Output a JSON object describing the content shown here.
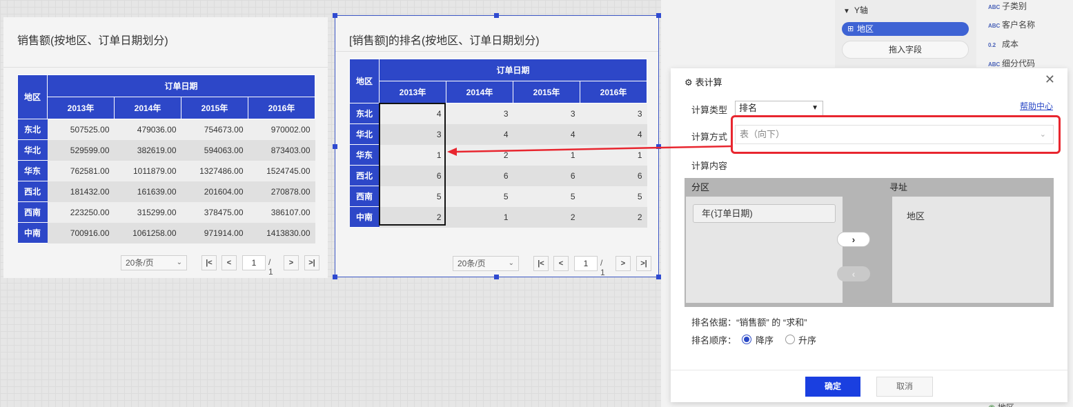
{
  "widget1": {
    "title": "销售额(按地区、订单日期划分)",
    "table": {
      "region_header": "地区",
      "group_header": "订单日期",
      "years": [
        "2013年",
        "2014年",
        "2015年",
        "2016年"
      ],
      "rows": [
        {
          "region": "东北",
          "values": [
            "507525.00",
            "479036.00",
            "754673.00",
            "970002.00"
          ]
        },
        {
          "region": "华北",
          "values": [
            "529599.00",
            "382619.00",
            "594063.00",
            "873403.00"
          ]
        },
        {
          "region": "华东",
          "values": [
            "762581.00",
            "1011879.00",
            "1327486.00",
            "1524745.00"
          ]
        },
        {
          "region": "西北",
          "values": [
            "181432.00",
            "161639.00",
            "201604.00",
            "270878.00"
          ]
        },
        {
          "region": "西南",
          "values": [
            "223250.00",
            "315299.00",
            "378475.00",
            "386107.00"
          ]
        },
        {
          "region": "中南",
          "values": [
            "700916.00",
            "1061258.00",
            "971914.00",
            "1413830.00"
          ]
        }
      ]
    },
    "pager": {
      "page_size": "20条/页",
      "page": "1",
      "total": "/ 1"
    }
  },
  "widget2": {
    "title": "[销售额]的排名(按地区、订单日期划分)",
    "table": {
      "region_header": "地区",
      "group_header": "订单日期",
      "years": [
        "2013年",
        "2014年",
        "2015年",
        "2016年"
      ],
      "rows": [
        {
          "region": "东北",
          "values": [
            "4",
            "3",
            "3",
            "3"
          ]
        },
        {
          "region": "华北",
          "values": [
            "3",
            "4",
            "4",
            "4"
          ]
        },
        {
          "region": "华东",
          "values": [
            "1",
            "2",
            "1",
            "1"
          ]
        },
        {
          "region": "西北",
          "values": [
            "6",
            "6",
            "6",
            "6"
          ]
        },
        {
          "region": "西南",
          "values": [
            "5",
            "5",
            "5",
            "5"
          ]
        },
        {
          "region": "中南",
          "values": [
            "2",
            "1",
            "2",
            "2"
          ]
        }
      ]
    },
    "pager": {
      "page_size": "20条/页",
      "page": "1",
      "total": "/ 1"
    }
  },
  "right_panel": {
    "y_axis_label": "Y轴",
    "y_field": "地区",
    "drop_placeholder": "拖入字段",
    "fields": [
      {
        "type": "ABC",
        "name": "子类别"
      },
      {
        "type": "ABC",
        "name": "客户名称"
      },
      {
        "type": "0.2",
        "name": "成本"
      },
      {
        "type": "ABC",
        "name": "细分代码"
      }
    ],
    "bottom_field_partial": "地区"
  },
  "dialog": {
    "title": "表计算",
    "calc_type_label": "计算类型",
    "calc_type_value": "排名",
    "help_link": "帮助中心",
    "calc_method_label": "计算方式",
    "calc_method_value": "表（向下）",
    "calc_content_label": "计算内容",
    "partition_label": "分区",
    "addressing_label": "寻址",
    "partition_items": [
      "年(订单日期)"
    ],
    "addressing_items": [
      "地区"
    ],
    "rank_basis": "排名依据：“销售额” 的 “求和”",
    "rank_order_label": "排名顺序：",
    "order_desc": "降序",
    "order_asc": "升序",
    "selected_order": "降序",
    "ok": "确定",
    "cancel": "取消"
  },
  "colors": {
    "header_blue": "#2d47c8",
    "accent": "#1a3fe0",
    "annotation_red": "#e8262f"
  }
}
